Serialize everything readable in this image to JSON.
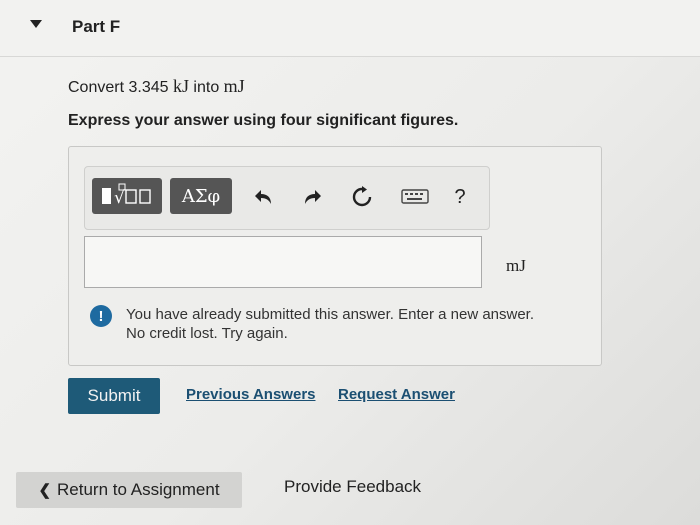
{
  "part": {
    "title": "Part F"
  },
  "question": {
    "prompt_prefix": "Convert 3.345 ",
    "prompt_from_unit": "kJ",
    "prompt_middle": " into ",
    "prompt_to_unit": "mJ",
    "instruction": "Express your answer using four significant figures."
  },
  "toolbar": {
    "templates_icon": "templates-icon",
    "greek_label": "ΑΣφ",
    "undo_icon": "undo-icon",
    "redo_icon": "redo-icon",
    "reset_icon": "reset-icon",
    "keyboard_icon": "keyboard-icon",
    "help_label": "?"
  },
  "answer": {
    "value": "",
    "unit": "mJ"
  },
  "alert": {
    "line1": "You have already submitted this answer. Enter a new answer.",
    "line2": "No credit lost. Try again."
  },
  "actions": {
    "submit_label": "Submit",
    "previous_answers_label": "Previous Answers",
    "request_answer_label": "Request Answer"
  },
  "footer": {
    "return_label": "Return to Assignment",
    "feedback_label": "Provide Feedback"
  },
  "colors": {
    "submit_bg": "#1e5a78",
    "link": "#1b4f72",
    "alert_icon": "#1e6aa0"
  }
}
